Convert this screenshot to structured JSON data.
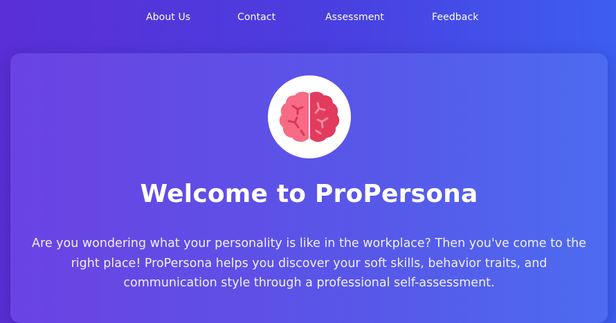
{
  "nav": {
    "items": [
      {
        "label": "About Us"
      },
      {
        "label": "Contact"
      },
      {
        "label": "Assessment"
      },
      {
        "label": "Feedback"
      }
    ]
  },
  "hero": {
    "logo_icon": "brain-icon",
    "title": "Welcome to ProPersona",
    "intro": "Are you wondering what your personality is like in the workplace? Then you've come to the right place! ProPersona helps you discover your soft skills, behavior traits, and communication style through a professional self-assessment."
  },
  "colors": {
    "background_start": "#5a2fd6",
    "background_end": "#3d5ef0",
    "brain_light": "#f76b84",
    "brain_dark": "#e23b5d",
    "logo_background": "#ffffff"
  }
}
